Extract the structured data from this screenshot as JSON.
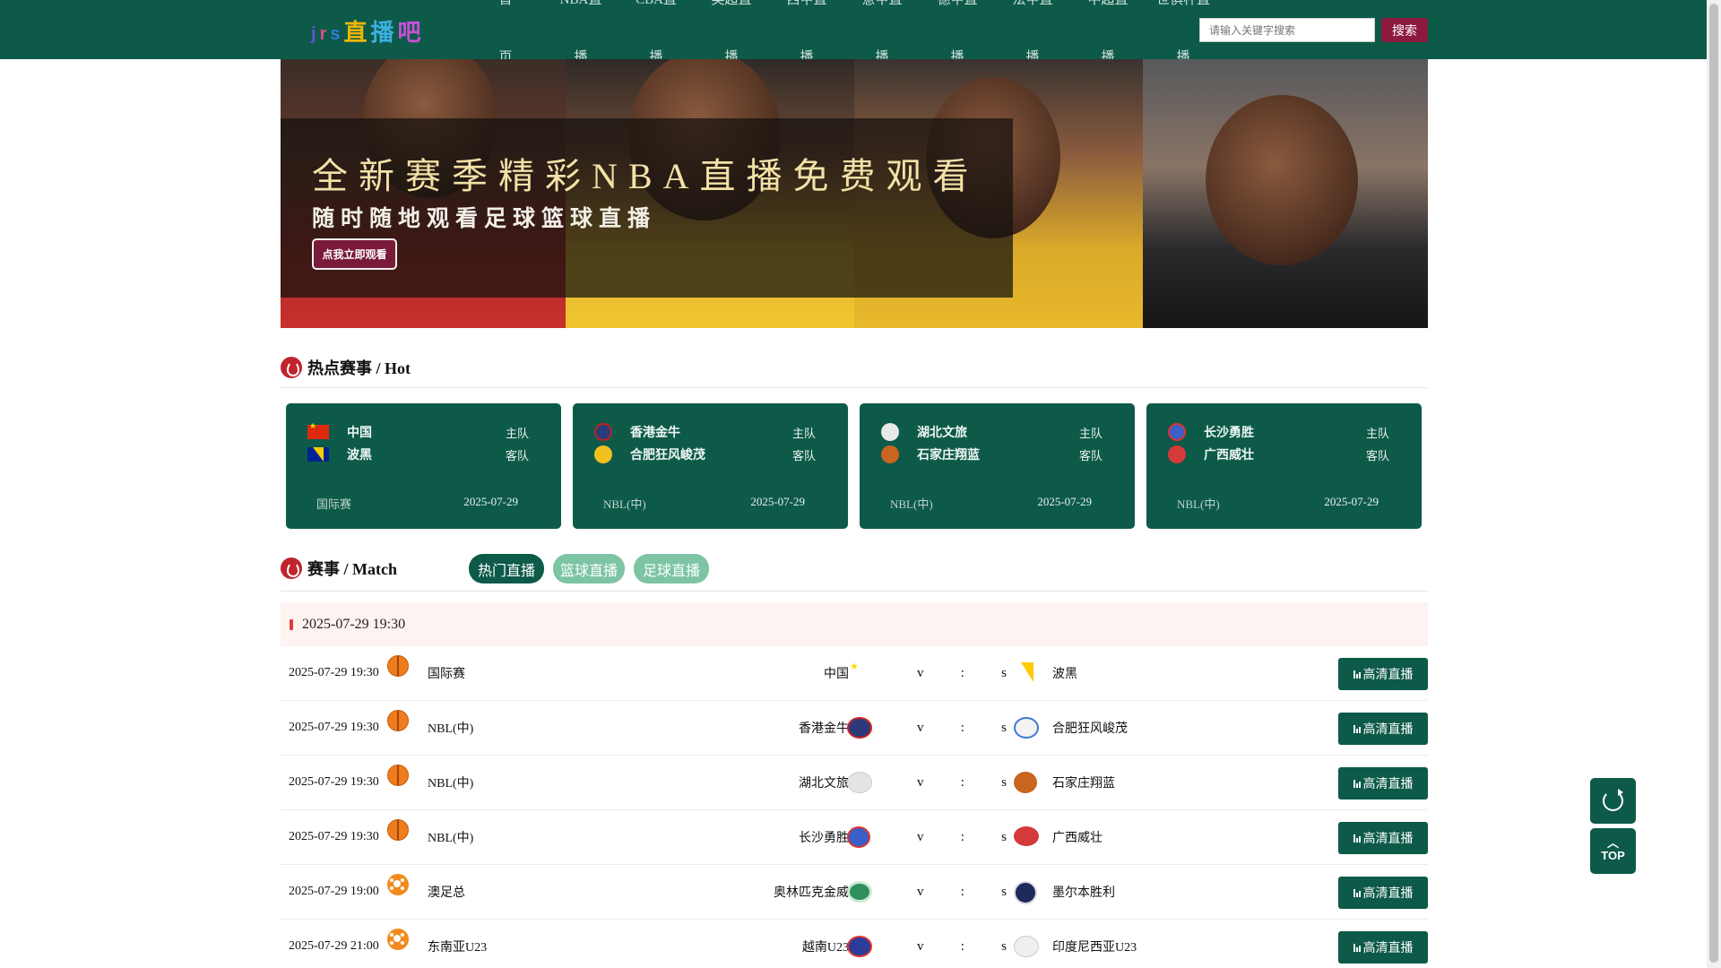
{
  "header": {
    "logo_text": [
      "j",
      "r",
      "s",
      "直",
      "播",
      "吧"
    ],
    "nav": [
      {
        "top": "首",
        "bottom": "页"
      },
      {
        "top": "NBA直",
        "bottom": "播"
      },
      {
        "top": "CBA直",
        "bottom": "播"
      },
      {
        "top": "英超直",
        "bottom": "播"
      },
      {
        "top": "西甲直",
        "bottom": "播"
      },
      {
        "top": "意甲直",
        "bottom": "播"
      },
      {
        "top": "德甲直",
        "bottom": "播"
      },
      {
        "top": "法甲直",
        "bottom": "播"
      },
      {
        "top": "中超直",
        "bottom": "播"
      },
      {
        "top": "世俱杯直",
        "bottom": "播"
      }
    ],
    "search_placeholder": "请输入关键字搜索",
    "search_button": "搜索"
  },
  "banner": {
    "title": "全新赛季精彩NBA直播免费观看",
    "subtitle": "随时随地观看足球篮球直播",
    "button": "点我立即观看"
  },
  "hot": {
    "heading": "热点赛事 / Hot",
    "home_label": "主队",
    "away_label": "客队",
    "cards": [
      {
        "home": "中国",
        "away": "波黑",
        "league": "国际赛",
        "date": "2025-07-29"
      },
      {
        "home": "香港金牛",
        "away": "合肥狂风峻茂",
        "league": "NBL(中)",
        "date": "2025-07-29"
      },
      {
        "home": "湖北文旅",
        "away": "石家庄翔蓝",
        "league": "NBL(中)",
        "date": "2025-07-29"
      },
      {
        "home": "长沙勇胜",
        "away": "广西威壮",
        "league": "NBL(中)",
        "date": "2025-07-29"
      }
    ]
  },
  "match": {
    "heading": "赛事 / Match",
    "tabs": [
      "热门直播",
      "篮球直播",
      "足球直播"
    ],
    "date_header": "2025-07-29 19:30",
    "vs": [
      "v",
      ":",
      "s"
    ],
    "button_label": "高清直播",
    "rows": [
      {
        "time": "2025-07-29 19:30",
        "sport": "basketball",
        "league": "国际赛",
        "home": "中国",
        "away": "波黑"
      },
      {
        "time": "2025-07-29 19:30",
        "sport": "basketball",
        "league": "NBL(中)",
        "home": "香港金牛",
        "away": "合肥狂风峻茂"
      },
      {
        "time": "2025-07-29 19:30",
        "sport": "basketball",
        "league": "NBL(中)",
        "home": "湖北文旅",
        "away": "石家庄翔蓝"
      },
      {
        "time": "2025-07-29 19:30",
        "sport": "basketball",
        "league": "NBL(中)",
        "home": "长沙勇胜",
        "away": "广西威壮"
      },
      {
        "time": "2025-07-29 19:00",
        "sport": "soccer",
        "league": "澳足总",
        "home": "奥林匹克金威",
        "away": "墨尔本胜利"
      },
      {
        "time": "2025-07-29 21:00",
        "sport": "soccer",
        "league": "东南亚U23",
        "home": "越南U23",
        "away": "印度尼西亚U23"
      }
    ]
  },
  "floating": {
    "top_label": "TOP"
  },
  "colors": {
    "primary": "#0d5a49",
    "accent": "#8c1a3e",
    "tab_inactive": "#7cc4a3"
  }
}
